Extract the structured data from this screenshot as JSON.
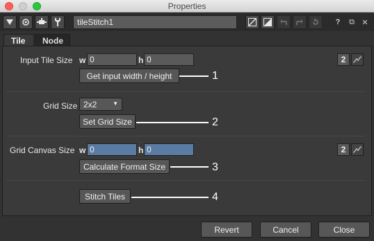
{
  "window": {
    "title": "Properties"
  },
  "toolbar": {
    "node_name": "tileStitch1",
    "help_label": "?",
    "float_label": "⧉",
    "close_label": "✕"
  },
  "tabs": [
    {
      "label": "Tile",
      "active": true
    },
    {
      "label": "Node",
      "active": false
    }
  ],
  "input_tile_size": {
    "label": "Input Tile Size",
    "w_label": "w",
    "h_label": "h",
    "w_value": "0",
    "h_value": "0",
    "anim_value": "2",
    "button_label": "Get input width / height",
    "callout": "1"
  },
  "grid_size": {
    "label": "Grid Size",
    "selected": "2x2",
    "button_label": "Set Grid Size",
    "callout": "2"
  },
  "grid_canvas_size": {
    "label": "Grid Canvas Size",
    "w_label": "w",
    "h_label": "h",
    "w_value": "0",
    "h_value": "0",
    "anim_value": "2",
    "button_label": "Calculate Format Size",
    "callout": "3"
  },
  "stitch": {
    "button_label": "Stitch Tiles",
    "callout": "4"
  },
  "footer": {
    "revert_label": "Revert",
    "cancel_label": "Cancel",
    "close_label": "Close"
  }
}
